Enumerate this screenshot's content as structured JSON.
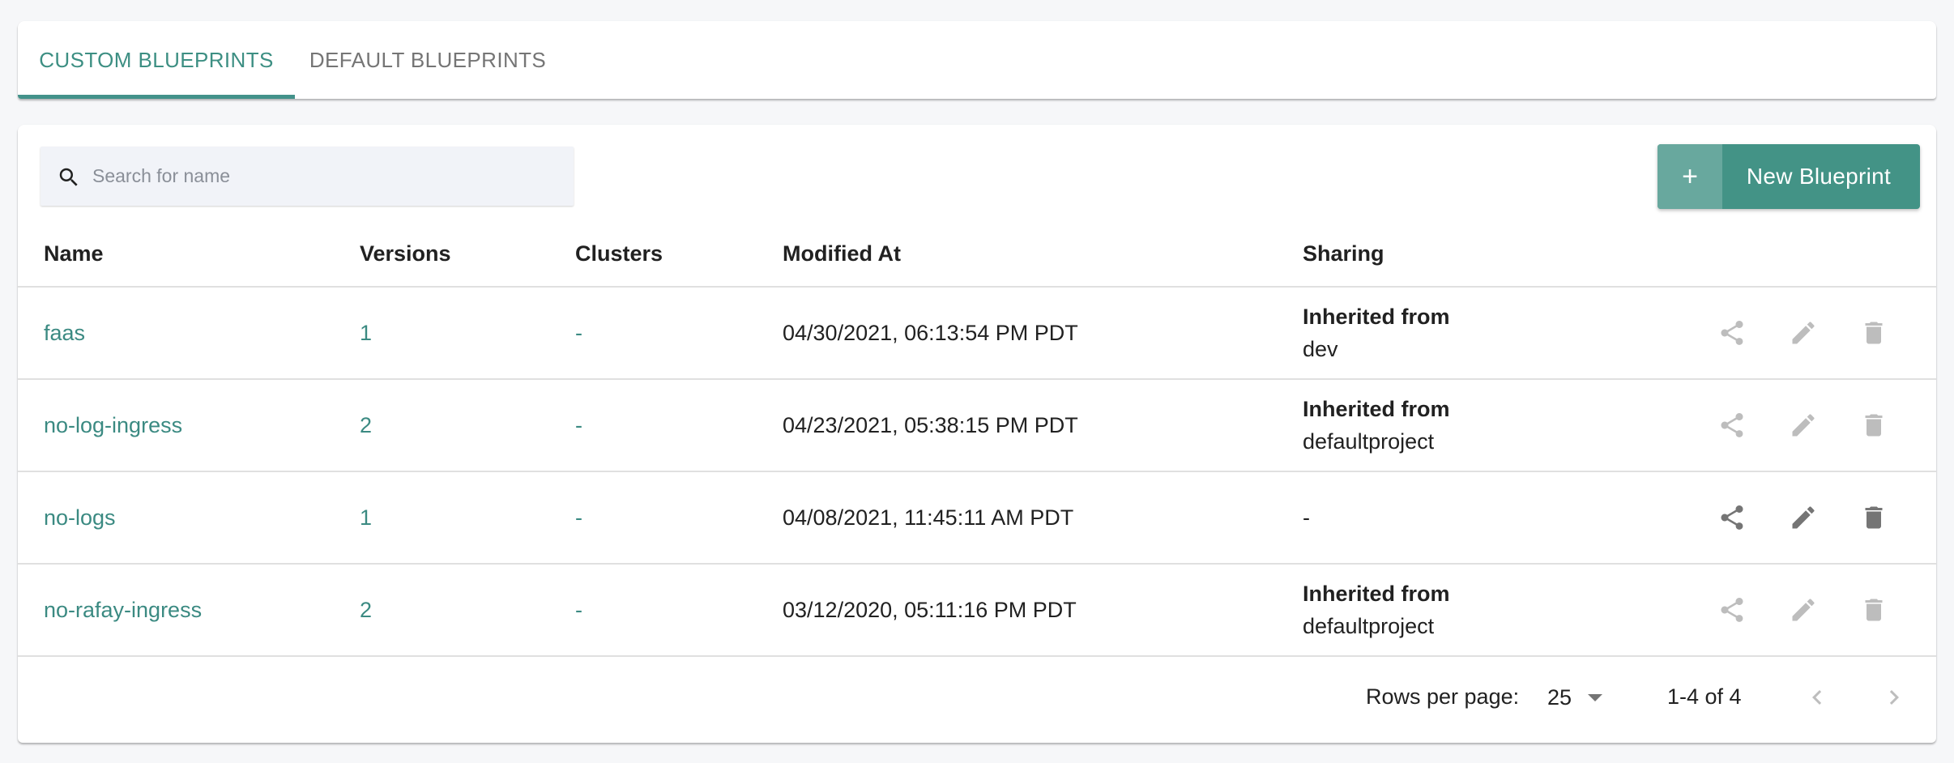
{
  "tabs": [
    {
      "label": "CUSTOM BLUEPRINTS",
      "active": true
    },
    {
      "label": "DEFAULT BLUEPRINTS",
      "active": false
    }
  ],
  "search": {
    "placeholder": "Search for name",
    "value": "",
    "icon": "search-icon"
  },
  "new_button": {
    "label": "New Blueprint",
    "icon": "plus-icon"
  },
  "table": {
    "columns": [
      "Name",
      "Versions",
      "Clusters",
      "Modified At",
      "Sharing"
    ],
    "rows": [
      {
        "name": "faas",
        "versions": "1",
        "clusters": "-",
        "modified": "04/30/2021, 06:13:54 PM PDT",
        "sharing_label": "Inherited from",
        "sharing_source": "dev",
        "actions_enabled": false
      },
      {
        "name": "no-log-ingress",
        "versions": "2",
        "clusters": "-",
        "modified": "04/23/2021, 05:38:15 PM PDT",
        "sharing_label": "Inherited from",
        "sharing_source": "defaultproject",
        "actions_enabled": false
      },
      {
        "name": "no-logs",
        "versions": "1",
        "clusters": "-",
        "modified": "04/08/2021, 11:45:11 AM PDT",
        "sharing_label": "",
        "sharing_source": "-",
        "actions_enabled": true
      },
      {
        "name": "no-rafay-ingress",
        "versions": "2",
        "clusters": "-",
        "modified": "03/12/2020, 05:11:16 PM PDT",
        "sharing_label": "Inherited from",
        "sharing_source": "defaultproject",
        "actions_enabled": false
      }
    ],
    "action_icons": [
      "share-icon",
      "edit-icon",
      "delete-icon"
    ]
  },
  "pagination": {
    "rows_per_page_label": "Rows per page:",
    "rows_per_page_value": "25",
    "range_text": "1-4 of 4",
    "prev_icon": "chevron-left-icon",
    "next_icon": "chevron-right-icon"
  },
  "colors": {
    "accent": "#43928a",
    "link": "#3b8a82",
    "button": "#439386",
    "button_icon_bg": "#68a89e",
    "icon_enabled": "#757575",
    "icon_disabled": "#bdbdbd",
    "background": "#f6f7f9"
  }
}
